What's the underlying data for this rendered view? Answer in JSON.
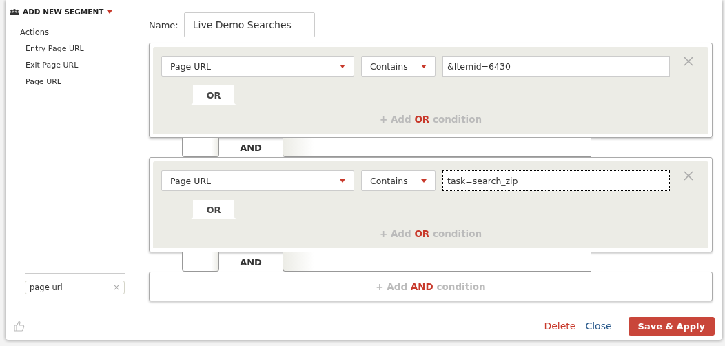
{
  "header": {
    "title": "ADD NEW SEGMENT"
  },
  "sidebar": {
    "group": "Actions",
    "items": [
      "Entry Page URL",
      "Exit Page URL",
      "Page URL"
    ],
    "search": {
      "value": "page url",
      "clear": "×"
    }
  },
  "name": {
    "label": "Name:",
    "value": "Live Demo Searches"
  },
  "blocks": [
    {
      "conditions": [
        {
          "field": "Page URL",
          "operator": "Contains",
          "value": "&Itemid=6430",
          "focused": false
        }
      ],
      "or_label": "OR",
      "add_or": [
        "+ Add",
        "OR",
        "condition"
      ],
      "and_label": "AND"
    },
    {
      "conditions": [
        {
          "field": "Page URL",
          "operator": "Contains",
          "value": "task=search_zip",
          "focused": true
        }
      ],
      "or_label": "OR",
      "add_or": [
        "+ Add",
        "OR",
        "condition"
      ],
      "and_label": "AND"
    }
  ],
  "add_and": [
    "+ Add",
    "AND",
    "condition"
  ],
  "footer": {
    "delete": "Delete",
    "close": "Close",
    "save": "Save & Apply"
  }
}
